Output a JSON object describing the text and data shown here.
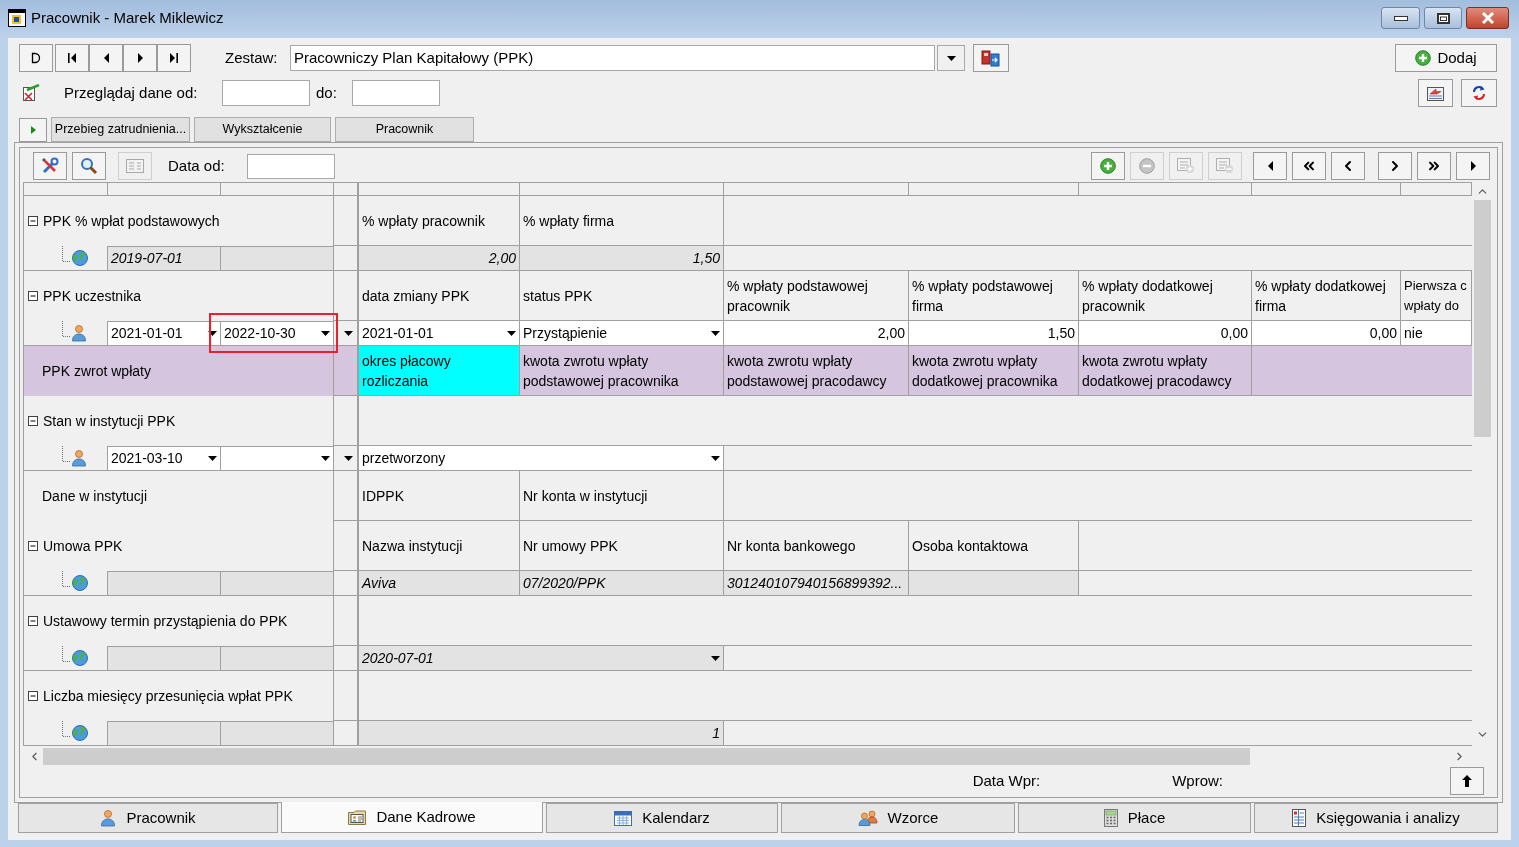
{
  "window": {
    "title": "Pracownik - Marek Miklewicz"
  },
  "toolbar": {
    "set_label": "Zestaw:",
    "set_value": "Pracowniczy Plan Kapitałowy (PPK)",
    "add_button": "Dodaj"
  },
  "date_filter": {
    "from_label": "Przeglądaj dane od:",
    "to_label": "do:"
  },
  "tabs": [
    {
      "label": "Przebieg zatrudnienia..."
    },
    {
      "label": "Wykształcenie"
    },
    {
      "label": "Pracownik"
    }
  ],
  "grid_toolbar": {
    "date_label": "Data od:",
    "left_buttons": [
      {
        "disabled": false
      },
      {
        "disabled": false
      },
      {
        "disabled": true
      }
    ],
    "record_buttons": [
      {
        "disabled": false
      },
      {
        "disabled": true
      },
      {
        "disabled": true
      },
      {
        "disabled": true
      }
    ]
  },
  "grid": {
    "rows": [
      {
        "kind": "group",
        "label": "PPK % wpłat podstawowych",
        "expanded": true,
        "headers": [
          {
            "text": "% wpłaty pracownik"
          },
          {
            "text": "% wpłaty firma"
          }
        ]
      },
      {
        "kind": "default_value",
        "from": "2019-07-01",
        "cells": [
          {
            "kind": "number",
            "value": "2,00"
          },
          {
            "kind": "number",
            "value": "1,50"
          }
        ]
      },
      {
        "kind": "group",
        "label": "PPK uczestnika",
        "expanded": true,
        "headers": [
          {
            "text": "data zmiany PPK"
          },
          {
            "text": "status PPK"
          },
          {
            "text": "% wpłaty podstawowej pracownik"
          },
          {
            "text": "% wpłaty podstawowej firma"
          },
          {
            "text": "% wpłaty dodatkowej pracownik"
          },
          {
            "text": "% wpłaty dodatkowej firma"
          },
          {
            "text": "Pierwsza c wpłaty do"
          }
        ]
      },
      {
        "kind": "employee_value",
        "from": "2021-01-01",
        "to": "2022-10-30",
        "to_marked": true,
        "cells": [
          {
            "kind": "choice",
            "value": "2021-01-01"
          },
          {
            "kind": "choice",
            "value": "Przystąpienie"
          },
          {
            "kind": "number",
            "value": "2,00"
          },
          {
            "kind": "number",
            "value": "1,50"
          },
          {
            "kind": "number",
            "value": "0,00"
          },
          {
            "kind": "number",
            "value": "0,00"
          },
          {
            "kind": "text",
            "value": "nie"
          }
        ]
      },
      {
        "kind": "section",
        "label": "PPK zwrot wpłaty",
        "color": "#d5c5de",
        "headers": [
          {
            "text": "okres płacowy rozliczania",
            "color": "#00ffff"
          },
          {
            "text": "kwota zwrotu wpłaty podstawowej pracownika"
          },
          {
            "text": "kwota zwrotu wpłaty podstawowej pracodawcy"
          },
          {
            "text": "kwota zwrotu wpłaty dodatkowej pracownika"
          },
          {
            "text": "kwota zwrotu wpłaty dodatkowej pracodawcy"
          }
        ]
      },
      {
        "kind": "group",
        "label": "Stan w instytucji PPK",
        "expanded": true
      },
      {
        "kind": "employee_value",
        "from": "2021-03-10",
        "to_marked": false,
        "cells": [
          {
            "kind": "choice",
            "value": "przetworzony",
            "wide": true
          }
        ]
      },
      {
        "kind": "section",
        "label": "Dane w instytucji",
        "headers": [
          {
            "text": "IDPPK"
          },
          {
            "text": "Nr konta w instytucji"
          }
        ]
      },
      {
        "kind": "group",
        "label": "Umowa PPK",
        "expanded": true,
        "headers": [
          {
            "text": "Nazwa instytucji"
          },
          {
            "text": "Nr umowy PPK"
          },
          {
            "text": "Nr konta bankowego"
          },
          {
            "text": "Osoba kontaktowa"
          }
        ]
      },
      {
        "kind": "default_value",
        "cells": [
          {
            "kind": "text",
            "value": "Aviva"
          },
          {
            "kind": "text",
            "value": "07/2020/PPK"
          },
          {
            "kind": "text",
            "value": "301240107940156899392..."
          }
        ]
      },
      {
        "kind": "group",
        "label": "Ustawowy termin przystąpienia do PPK",
        "expanded": true
      },
      {
        "kind": "default_value",
        "cells": [
          {
            "kind": "choice",
            "value": "2020-07-01",
            "wide": true
          }
        ]
      },
      {
        "kind": "group",
        "label": "Liczba miesięcy przesunięcia wpłat PPK",
        "expanded": true
      },
      {
        "kind": "default_value",
        "cells": [
          {
            "kind": "number",
            "value": "1",
            "wide": true
          }
        ]
      }
    ]
  },
  "footer": {
    "entry_date_label": "Data Wpr:",
    "entered_by_label": "Wprow:"
  },
  "bottom_tabs": [
    {
      "label": "Pracownik",
      "selected": false
    },
    {
      "label": "Dane Kadrowe",
      "selected": true
    },
    {
      "label": "Kalendarz",
      "selected": false
    },
    {
      "label": "Wzorce",
      "selected": false
    },
    {
      "label": "Płace",
      "selected": false
    },
    {
      "label": "Księgowania i analizy",
      "selected": false
    }
  ]
}
